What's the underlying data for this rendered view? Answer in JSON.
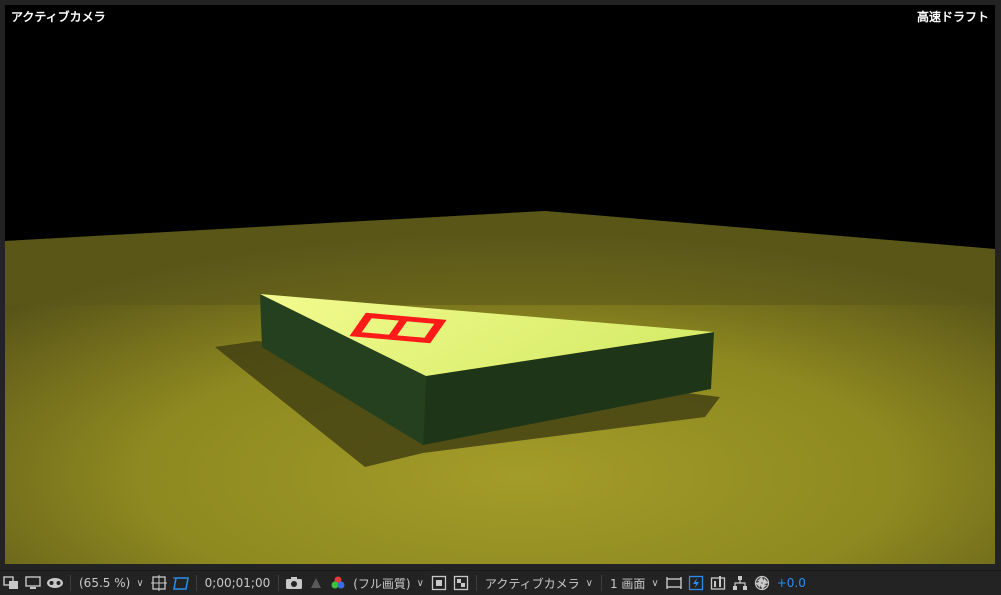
{
  "viewer": {
    "camera_label": "アクティブカメラ",
    "quality_label": "高速ドラフト"
  },
  "toolbar": {
    "zoom": "(65.5 %)",
    "timecode": "0;00;01;00",
    "resolution": "(フル画質)",
    "camera_view": "アクティブカメラ",
    "layout": "1 画面",
    "exposure": "+0.0"
  },
  "colors": {
    "accent": "#2d8ceb",
    "floor": "#8f8a22",
    "top_face": "#dff07a",
    "side_face": "#233a1d",
    "text_on_box": "#ff1a1a"
  },
  "icons": {
    "region": "always-preview-icon",
    "monitor": "monitor-icon",
    "mask": "mask-visibility-icon",
    "grid": "grid-guides-icon",
    "transparency": "transparency-grid-icon",
    "snapshot": "camera-snapshot-icon",
    "show_snapshot": "show-snapshot-icon",
    "channel": "rgb-channel-icon",
    "fast_preview": "fast-preview-icon",
    "flowchart": "flowchart-icon",
    "reset_exposure": "reset-exposure-icon"
  }
}
